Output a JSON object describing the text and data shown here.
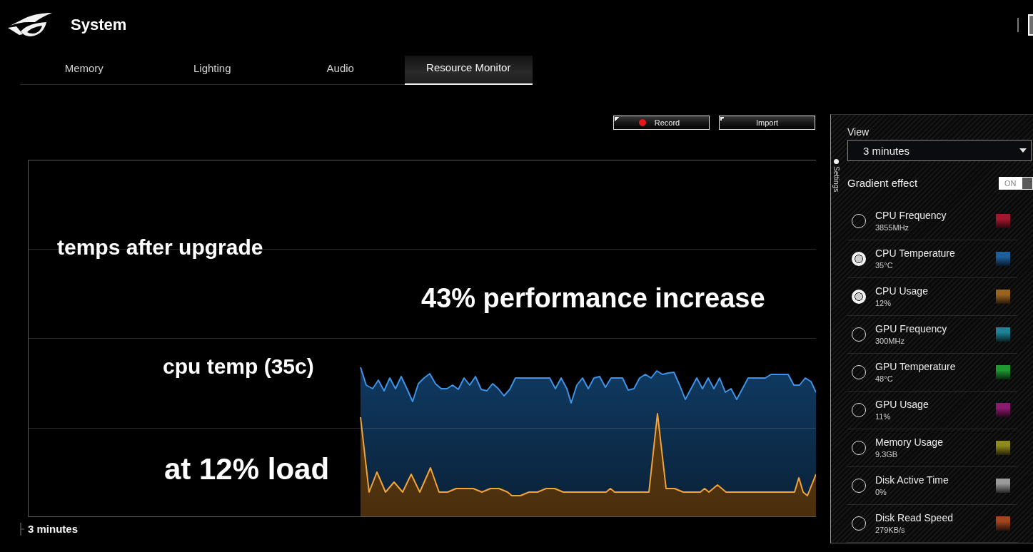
{
  "window": {
    "title": "System"
  },
  "tabs": [
    {
      "label": "Memory",
      "selected": false
    },
    {
      "label": "Lighting",
      "selected": false
    },
    {
      "label": "Audio",
      "selected": false
    },
    {
      "label": "Resource Monitor",
      "selected": true
    }
  ],
  "resource_monitor": {
    "buttons": [
      {
        "kind": "record",
        "label": "Record"
      },
      {
        "kind": "import",
        "label": "Import"
      }
    ],
    "chart": {
      "annotations": [
        "temps after upgrade",
        "43% performance increase",
        "cpu temp (35c)",
        "at 12% load"
      ]
    },
    "time_span": "3 minutes"
  },
  "settings_panel": {
    "tab_label": "Settings",
    "view": {
      "label": "View",
      "value": "3 minutes"
    },
    "gradient_effect": {
      "label": "Gradient effect",
      "on": true,
      "state_label": "ON"
    },
    "metrics": [
      {
        "name": "CPU Frequency",
        "value": "3855MHz",
        "checked": false,
        "color": "#a3182e"
      },
      {
        "name": "CPU Temperature",
        "value": "35°C",
        "checked": true,
        "color": "#1f5f9c"
      },
      {
        "name": "CPU Usage",
        "value": "12%",
        "checked": true,
        "color": "#9a6420"
      },
      {
        "name": "GPU Frequency",
        "value": "300MHz",
        "checked": false,
        "color": "#1c8494"
      },
      {
        "name": "GPU Temperature",
        "value": "48°C",
        "checked": false,
        "color": "#1f9a32"
      },
      {
        "name": "GPU Usage",
        "value": "11%",
        "checked": false,
        "color": "#8c1a6e"
      },
      {
        "name": "Memory Usage",
        "value": "9.3GB",
        "checked": false,
        "color": "#8f8a1c"
      },
      {
        "name": "Disk Active Time",
        "value": "0%",
        "checked": false,
        "color": "#9a9a9a"
      },
      {
        "name": "Disk Read Speed",
        "value": "279KB/s",
        "checked": false,
        "color": "#a3451e"
      }
    ]
  }
}
